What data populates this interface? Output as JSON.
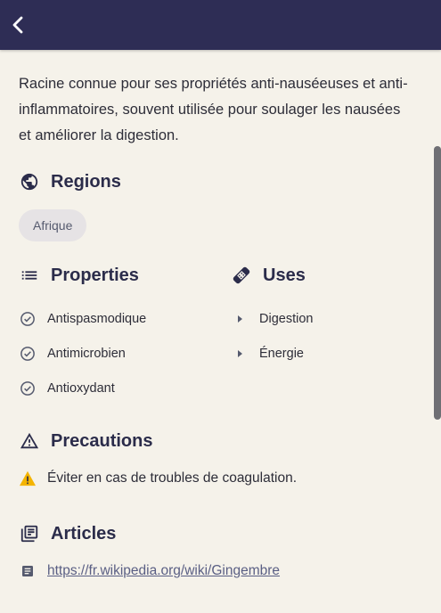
{
  "description": "Racine connue pour ses propriétés anti-nauséeuses et anti-inflammatoires, souvent utilisée pour soulager les nausées et améliorer la digestion.",
  "regions": {
    "title": "Regions",
    "icon": "globe-icon",
    "chips": [
      "Afrique"
    ]
  },
  "properties": {
    "title": "Properties",
    "icon": "list-icon",
    "items": [
      "Antispasmodique",
      "Antimicrobien",
      "Antioxydant"
    ]
  },
  "uses": {
    "title": "Uses",
    "icon": "bandage-icon",
    "items": [
      "Digestion",
      "Énergie"
    ]
  },
  "precautions": {
    "title": "Precautions",
    "icon": "warning-icon",
    "items": [
      "Éviter en cas de troubles de coagulation."
    ]
  },
  "articles": {
    "title": "Articles",
    "icon": "library-icon",
    "links": [
      "https://fr.wikipedia.org/wiki/Gingembre"
    ]
  },
  "colors": {
    "appbar": "#2e2d55",
    "background": "#f5f2ea",
    "heading": "#2b2c4a",
    "warning": "#f4b400",
    "link": "#5a5f84"
  }
}
